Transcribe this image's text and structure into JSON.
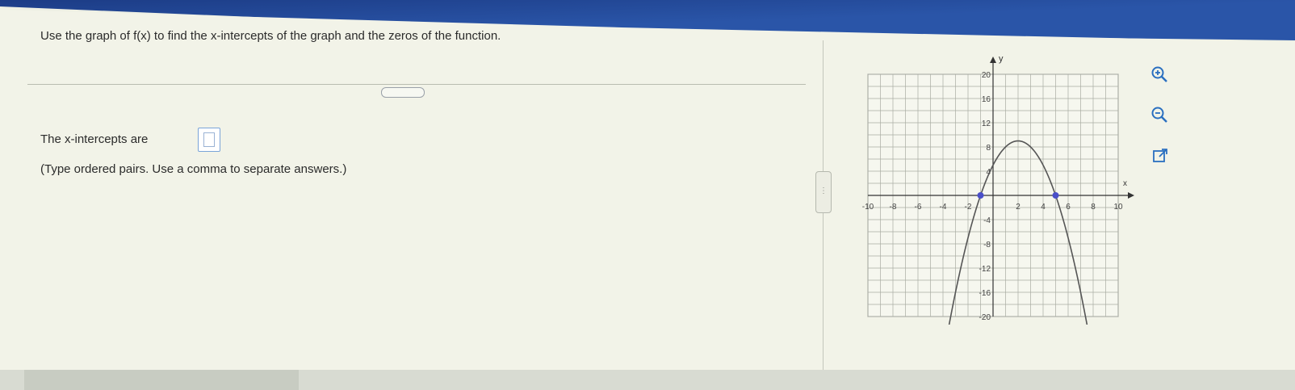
{
  "question": {
    "text": "Use the graph of f(x) to find the x-intercepts of the graph and the zeros of the function."
  },
  "answer": {
    "label": "The x-intercepts are",
    "value": "",
    "hint": "(Type ordered pairs. Use a comma to separate answers.)"
  },
  "graph": {
    "x_axis_label": "x",
    "y_axis_label": "y",
    "x_ticks": [
      "-10",
      "-8",
      "-6",
      "-4",
      "-2",
      "2",
      "4",
      "6",
      "8",
      "10"
    ],
    "y_ticks": [
      "20",
      "16",
      "12",
      "8",
      "4",
      "-4",
      "-8",
      "-12",
      "-16",
      "-20"
    ],
    "x_range": [
      -10,
      10
    ],
    "y_range": [
      -20,
      20
    ],
    "grid": true,
    "curve_color": "#555555",
    "point_color": "#4a4fc9",
    "function": "f(x) = -(x+1)(x-5)",
    "x_intercepts": [
      [
        -1,
        0
      ],
      [
        5,
        0
      ]
    ]
  },
  "tools": {
    "zoom_in": "zoom-in-icon",
    "zoom_out": "zoom-out-icon",
    "popout": "external-link-icon"
  }
}
